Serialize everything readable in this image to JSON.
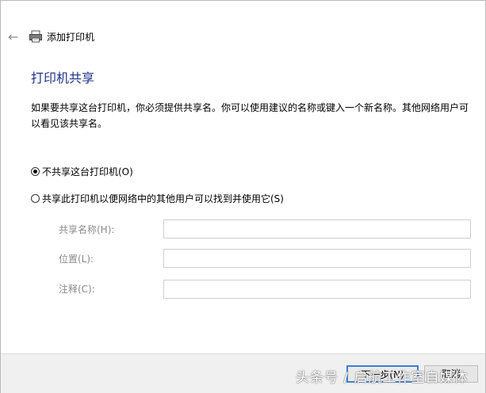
{
  "window": {
    "title": "添加打印机"
  },
  "page": {
    "heading": "打印机共享",
    "description": "如果要共享这台打印机，你必须提供共享名。你可以使用建议的名称或键入一个新名称。其他网络用户可以看见该共享名。"
  },
  "options": [
    {
      "label": "不共享这台打印机(O)",
      "checked": true
    },
    {
      "label": "共享此打印机以便网络中的其他用户可以找到并使用它(S)",
      "checked": false
    }
  ],
  "fields": [
    {
      "label": "共享名称(H):",
      "value": ""
    },
    {
      "label": "位置(L):",
      "value": ""
    },
    {
      "label": "注释(C):",
      "value": ""
    }
  ],
  "buttons": {
    "next": "下一步(N)",
    "cancel": "取消"
  },
  "watermark": "头条号 / 启航工作室自媒体",
  "icons": {
    "back": "back-arrow-icon",
    "printer": "printer-icon"
  },
  "colors": {
    "heading": "#1e3287",
    "focus_border": "#3c7fd6"
  }
}
